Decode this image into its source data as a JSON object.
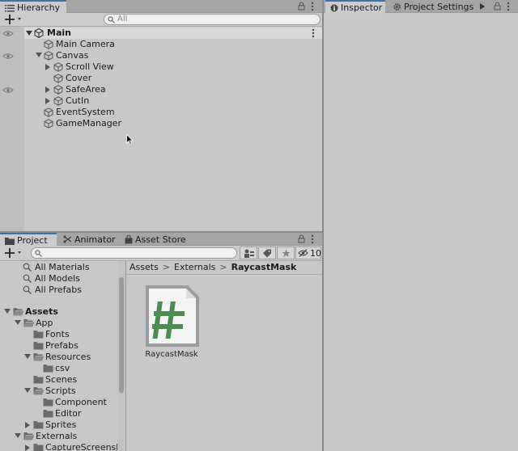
{
  "hierarchy": {
    "tab_label": "Hierarchy",
    "search_placeholder": "All",
    "scene": "Main",
    "items": [
      {
        "label": "Main Camera",
        "icon": "gameobject-icon"
      },
      {
        "label": "Canvas",
        "icon": "gameobject-icon"
      },
      {
        "label": "Scroll View",
        "icon": "gameobject-icon"
      },
      {
        "label": "Cover",
        "icon": "gameobject-icon"
      },
      {
        "label": "SafeArea",
        "icon": "gameobject-icon"
      },
      {
        "label": "CutIn",
        "icon": "gameobject-icon"
      },
      {
        "label": "EventSystem",
        "icon": "gameobject-icon"
      },
      {
        "label": "GameManager",
        "icon": "gameobject-icon"
      }
    ]
  },
  "inspector": {
    "tab_inspector": "Inspector",
    "tab_project_settings": "Project Settings"
  },
  "project": {
    "tab_project": "Project",
    "tab_animator": "Animator",
    "tab_asset_store": "Asset Store",
    "hidden_count": "10",
    "favorites": [
      "All Materials",
      "All Models",
      "All Prefabs"
    ],
    "assets_root": "Assets",
    "tree": [
      {
        "label": "App"
      },
      {
        "label": "Fonts"
      },
      {
        "label": "Prefabs"
      },
      {
        "label": "Resources"
      },
      {
        "label": "csv"
      },
      {
        "label": "Scenes"
      },
      {
        "label": "Scripts"
      },
      {
        "label": "Component"
      },
      {
        "label": "Editor"
      },
      {
        "label": "Sprites"
      },
      {
        "label": "Externals"
      },
      {
        "label": "CaptureScreensho"
      }
    ],
    "breadcrumb": [
      "Assets",
      "Externals",
      "RaycastMask"
    ],
    "assets": [
      {
        "name": "RaycastMask",
        "icon": "csharp-script-icon"
      }
    ]
  },
  "colors": {
    "panel_bg": "#c8c8c8",
    "tab_bar": "#a5a5a5",
    "accent": "#3a72b0",
    "script_icon_green": "#4f8a52"
  }
}
